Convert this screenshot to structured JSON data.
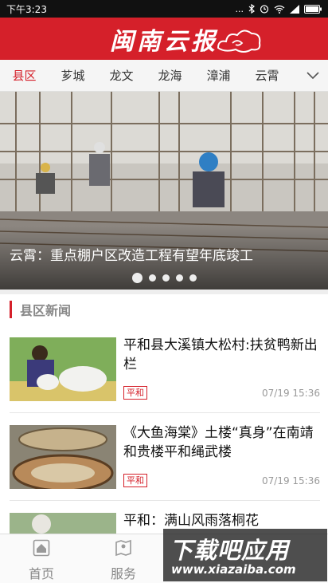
{
  "status": {
    "time": "下午3:23",
    "dots": "..."
  },
  "brand": {
    "name": "闽南云报"
  },
  "tabs": [
    {
      "label": "县区",
      "active": true
    },
    {
      "label": "芗城"
    },
    {
      "label": "龙文"
    },
    {
      "label": "龙海"
    },
    {
      "label": "漳浦"
    },
    {
      "label": "云霄"
    }
  ],
  "hero": {
    "caption": "云霄：重点棚户区改造工程有望年底竣工",
    "slide_count": 5,
    "active_slide": 1
  },
  "section": {
    "title": "县区新闻"
  },
  "news": [
    {
      "title": "平和县大溪镇大松村:扶贫鸭新出栏",
      "tag": "平和",
      "time": "07/19 15:36"
    },
    {
      "title": "《大鱼海棠》土楼“真身”在南靖和贵楼平和绳武楼",
      "tag": "平和",
      "time": "07/19 15:36"
    },
    {
      "title": "平和：满山风雨落桐花"
    }
  ],
  "bottom_nav": [
    {
      "label": "首页",
      "icon": "home-icon"
    },
    {
      "label": "服务",
      "icon": "map-icon"
    }
  ],
  "watermark": {
    "big": "下载吧应用",
    "small": "www.xiazaiba.com"
  },
  "colors": {
    "brand_red": "#d5202a",
    "tab_bg": "#f5f5f5"
  }
}
